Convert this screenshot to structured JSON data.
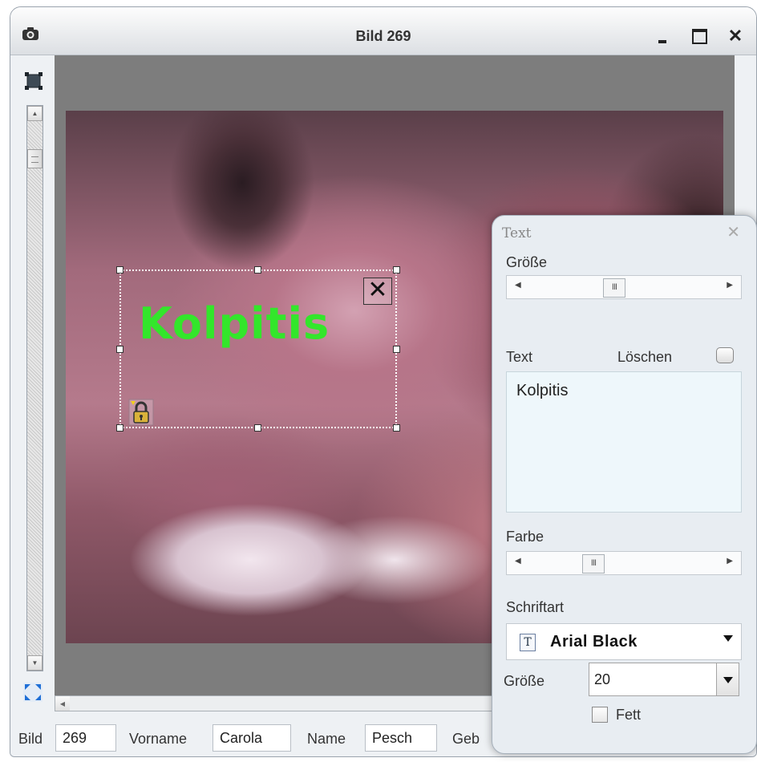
{
  "window": {
    "title": "Bild 269",
    "app_icon": "camera-icon",
    "controls": {
      "minimize": "minimize-icon",
      "maximize": "maximize-icon",
      "close": "✕"
    }
  },
  "toolbar": {
    "select_tool": "select-frame-icon",
    "fit_tool": "fit-screen-icon"
  },
  "annotation": {
    "text": "Kolpitis",
    "color": "#33e62b",
    "close_label": "✕",
    "lock_icon": "lock-icon"
  },
  "statusbar": {
    "bild_label": "Bild",
    "bild_value": "269",
    "vorname_label": "Vorname",
    "vorname_value": "Carola",
    "name_label": "Name",
    "name_value": "Pesch",
    "geb_label": "Geb"
  },
  "panel": {
    "title": "Text",
    "close_label": "✕",
    "size_label": "Größe",
    "text_label": "Text",
    "delete_label": "Löschen",
    "text_value": "Kolpitis",
    "color_label": "Farbe",
    "font_label": "Schriftart",
    "font_value": "Arial Black",
    "font_size_label": "Größe",
    "font_size_value": "20",
    "bold_label": "Fett",
    "thumb_glyph": "III"
  }
}
